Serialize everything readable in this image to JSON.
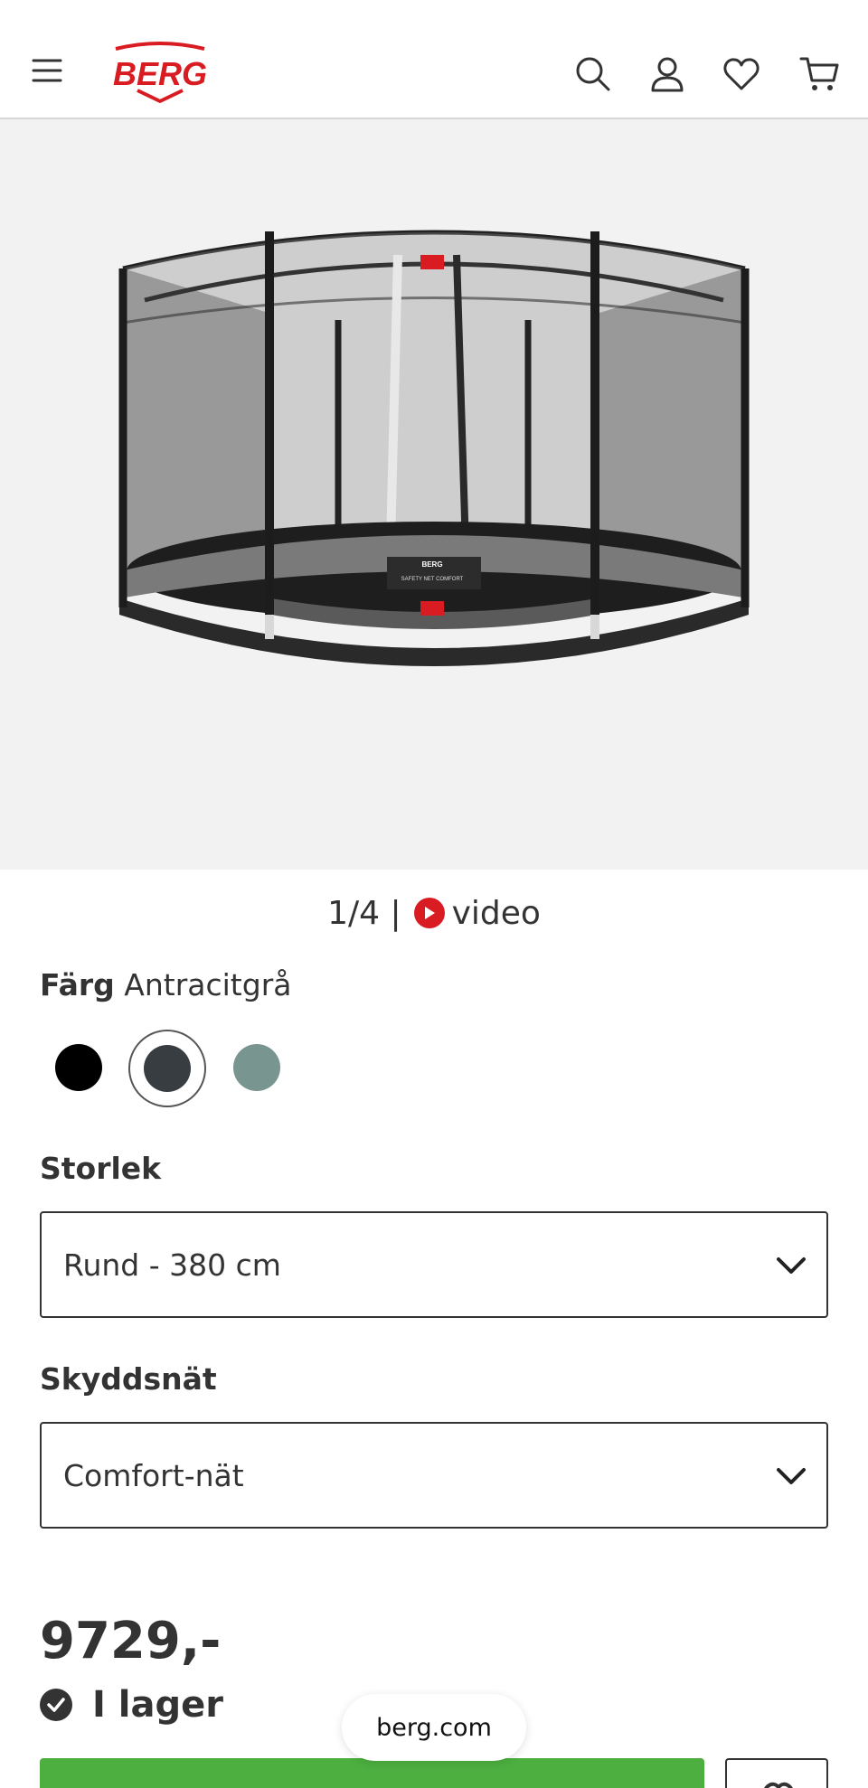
{
  "header": {
    "brand": "BERG",
    "icons": [
      "menu-icon",
      "search-icon",
      "account-icon",
      "heart-icon",
      "cart-icon"
    ]
  },
  "gallery": {
    "counter": "1/4 |",
    "video_label": "video",
    "product_labels": [
      "BERG",
      "SAFETY NET COMFORT"
    ]
  },
  "color_option": {
    "label": "Färg",
    "value": "Antracitgrå",
    "swatches": [
      {
        "name": "black",
        "hex": "#000000"
      },
      {
        "name": "antracitgra",
        "hex": "#383d42",
        "selected": true
      },
      {
        "name": "grey-green",
        "hex": "#78968f"
      }
    ]
  },
  "size_option": {
    "label": "Storlek",
    "value": "Rund - 380 cm"
  },
  "net_option": {
    "label": "Skyddsnät",
    "value": "Comfort-nät"
  },
  "price": "9729,-",
  "stock": "I lager",
  "browser": {
    "url": "berg.com"
  },
  "colors": {
    "accent_red": "#d91b22",
    "buy_green": "#4caf3f",
    "text": "#333333"
  }
}
